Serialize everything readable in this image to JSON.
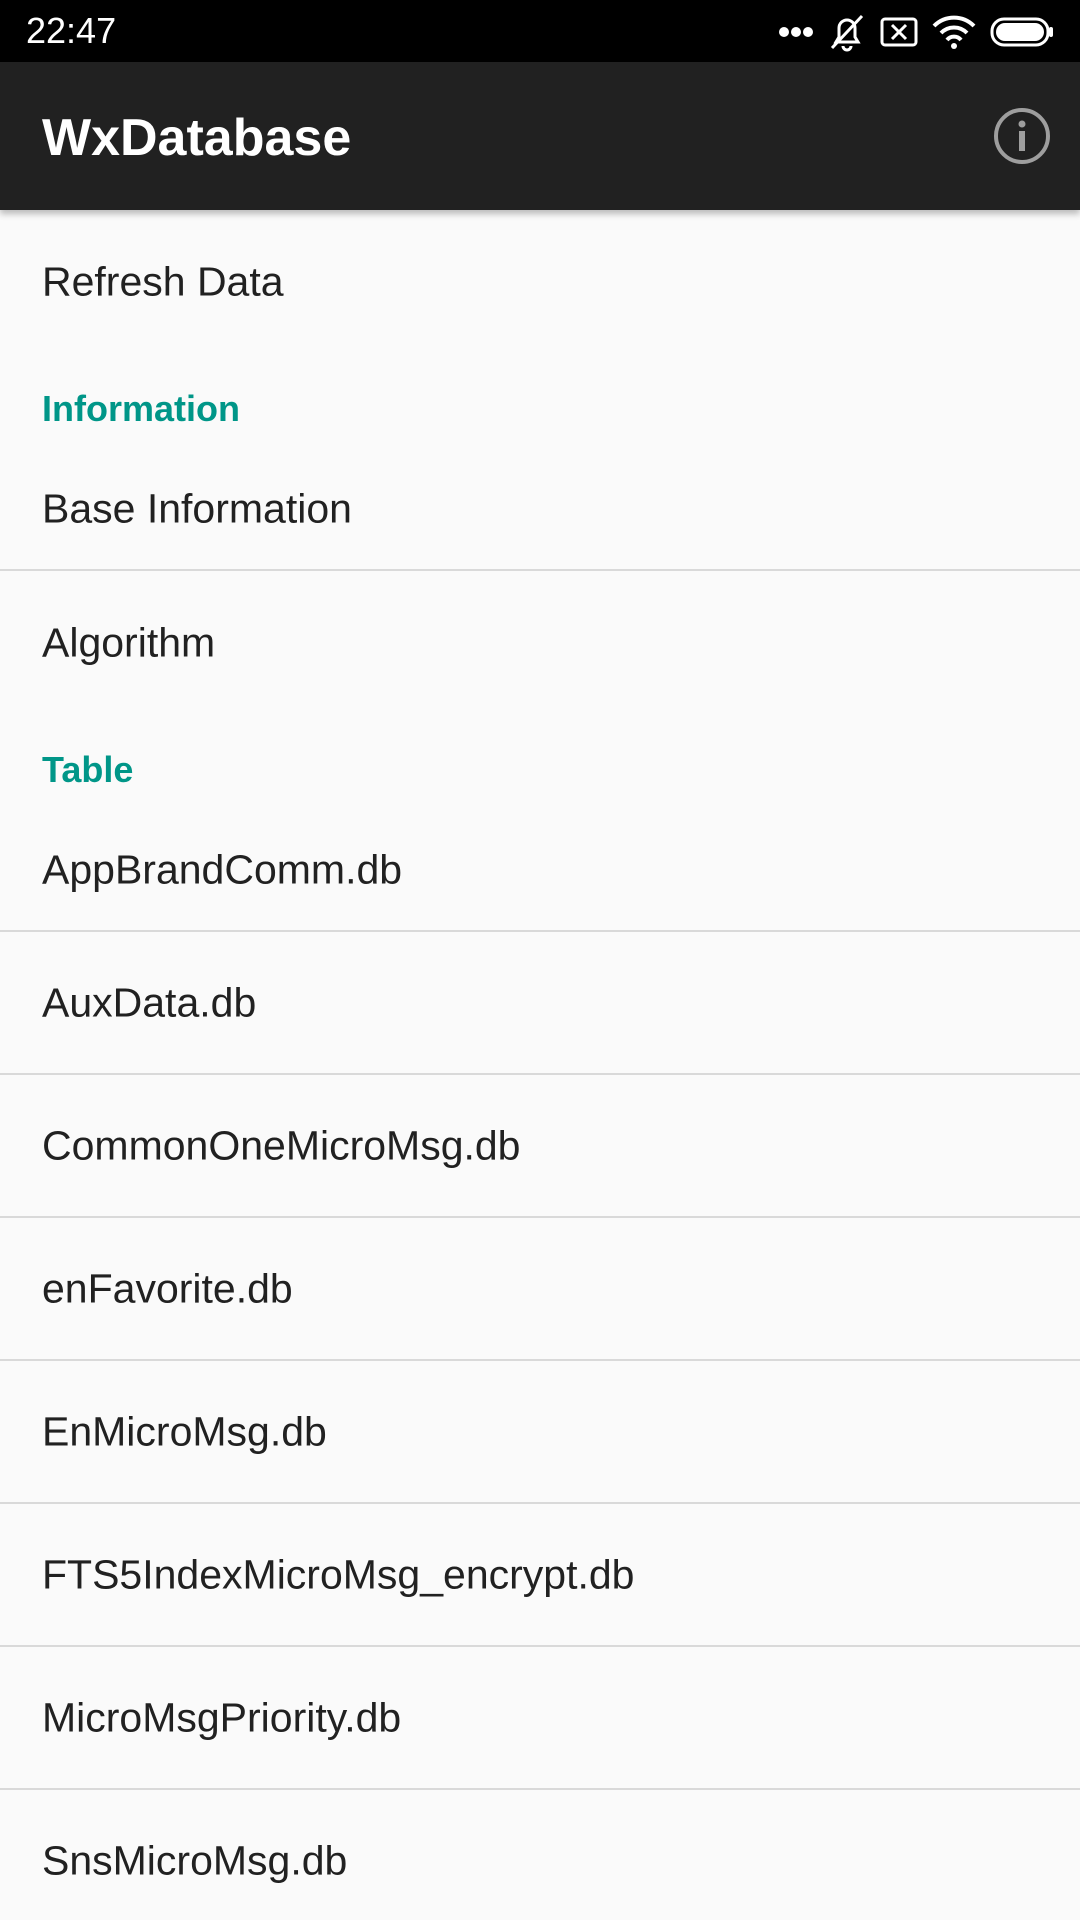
{
  "status_bar": {
    "time": "22:47",
    "icons": [
      "more-dots-icon",
      "alarm-off-icon",
      "sim-x-icon",
      "wifi-icon",
      "battery-icon"
    ]
  },
  "app_bar": {
    "title": "WxDatabase",
    "info_icon": "info-icon"
  },
  "items": {
    "refresh": "Refresh Data",
    "information_header": "Information",
    "base_information": "Base Information",
    "algorithm": "Algorithm",
    "table_header": "Table",
    "tables": [
      "AppBrandComm.db",
      "AuxData.db",
      "CommonOneMicroMsg.db",
      "enFavorite.db",
      "EnMicroMsg.db",
      "FTS5IndexMicroMsg_encrypt.db",
      "MicroMsgPriority.db",
      "SnsMicroMsg.db"
    ]
  },
  "colors": {
    "app_bar": "#212121",
    "accent": "#009688",
    "background": "#fafafa"
  }
}
